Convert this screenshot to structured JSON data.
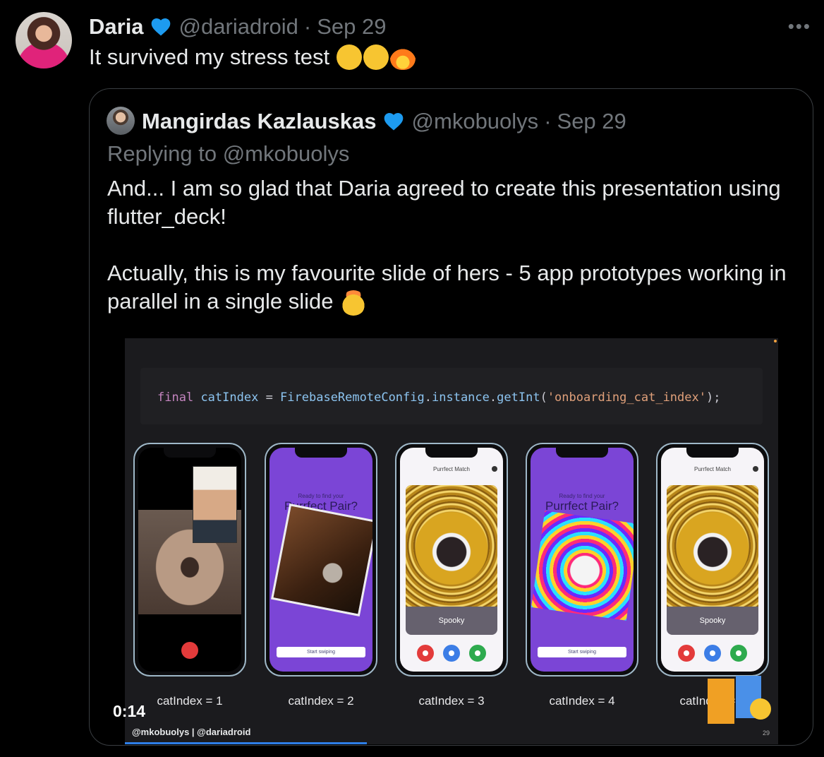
{
  "tweet": {
    "author_name": "Daria",
    "handle": "@dariadroid",
    "separator": "·",
    "date": "Sep 29",
    "more_label": "•••",
    "text": "It survived my stress test",
    "emoji_names": [
      "face-with-tears-of-joy-icon",
      "smirking-face-icon",
      "fire-icon"
    ]
  },
  "quoted": {
    "author_name": "Mangirdas Kazlauskas",
    "handle": "@mkobuolys",
    "separator": "·",
    "date": "Sep 29",
    "replying_to": "Replying to @mkobuolys",
    "paragraph_1": "And... I am so glad that Daria agreed to create this presentation using flutter_deck!",
    "paragraph_2": "Actually, this is my favourite slide of hers - 5 app prototypes working in parallel in a single slide",
    "paragraph_2_emoji": "exploding-head-icon"
  },
  "video": {
    "code": {
      "keyword": "final",
      "variable": "catIndex",
      "equals": " = ",
      "class_name": "FirebaseRemoteConfig",
      "dot1": ".",
      "member": "instance",
      "dot2": ".",
      "method": "getInt",
      "open": "(",
      "arg": "'onboarding_cat_index'",
      "close": ");"
    },
    "phones": {
      "ready_text": "Ready to find your",
      "headline": "Purrfect Pair?",
      "start_button": "Start swiping",
      "app_title": "Purrfect Match",
      "card_label": "Spooky"
    },
    "labels": [
      "catIndex = 1",
      "catIndex = 2",
      "catIndex = 3",
      "catIndex = 4",
      "catIndex = 5"
    ],
    "credit": "@mkobuolys | @dariadroid",
    "slide_number": "29",
    "time": "0:14",
    "progress": 0.37,
    "colors": {
      "accent": "#1d9bf0",
      "purple_screen": "#7b45d6",
      "progress": "#2e7ee6"
    }
  }
}
